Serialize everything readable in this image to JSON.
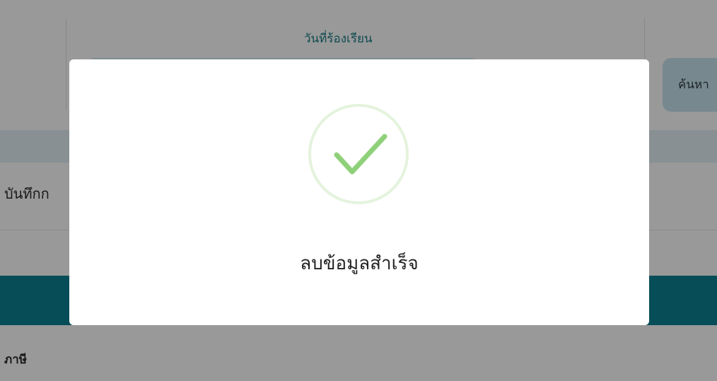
{
  "filter": {
    "date_label": "วันที่ร้องเรียน",
    "search_label": "ค้นหา"
  },
  "section": {
    "title": "บันทึกก"
  },
  "bottom": {
    "text": "ภาษี"
  },
  "modal": {
    "icon": "check-icon",
    "message": "ลบข้อมูลสำเร็จ"
  },
  "colors": {
    "accent": "#0a8193",
    "success": "#8fd17a",
    "label": "#1a7d86"
  }
}
